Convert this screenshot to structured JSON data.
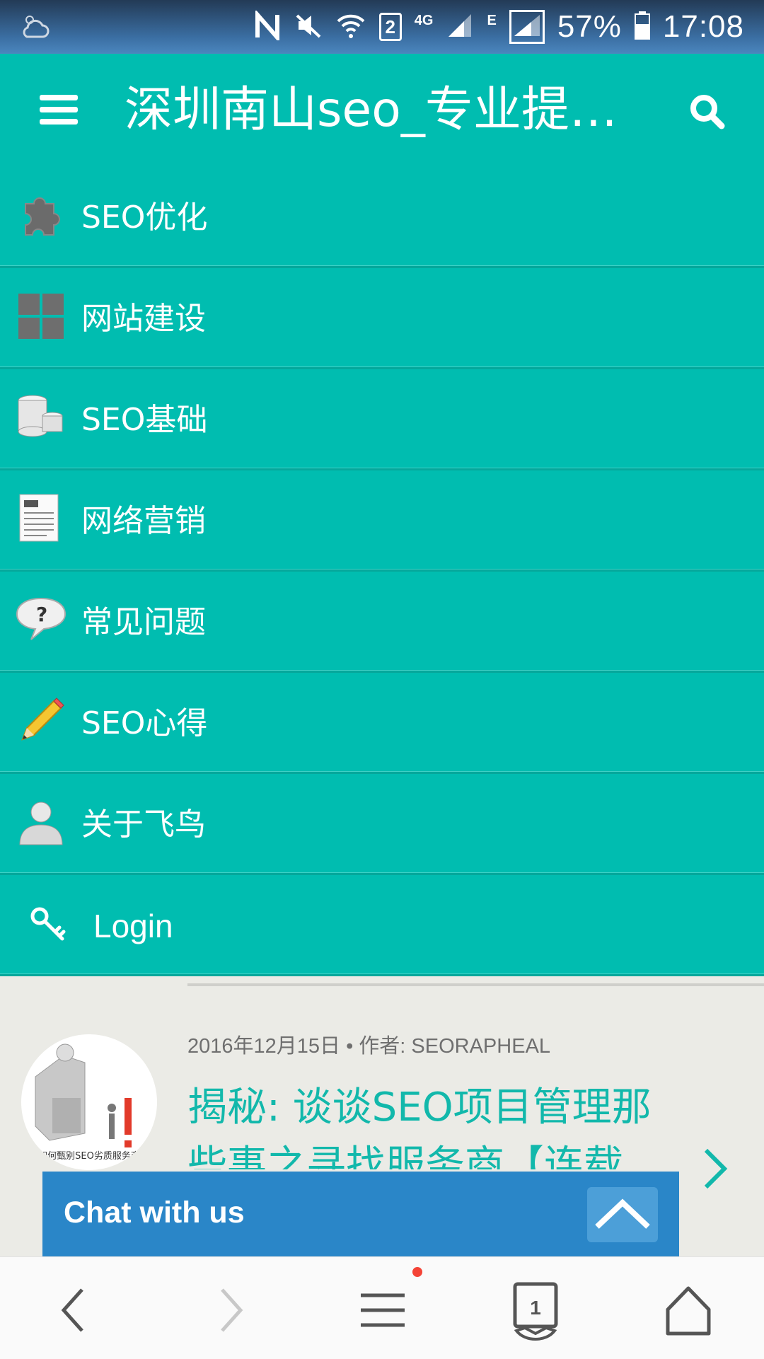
{
  "status_bar": {
    "battery": "57%",
    "time": "17:08",
    "sim_slot": "2",
    "network_4g": "4G",
    "network_e": "E",
    "icons": [
      "cloud-weather-icon",
      "nfc-icon",
      "mute-icon",
      "wifi-icon",
      "sim-icon",
      "signal-icon",
      "signal-icon",
      "battery-icon"
    ]
  },
  "app_bar": {
    "title": "深圳南山seo_专业提供…",
    "menu_icon": "hamburger-menu-icon",
    "search_icon": "search-icon"
  },
  "menu": {
    "items": [
      {
        "label": "SEO优化",
        "icon": "puzzle-piece-icon"
      },
      {
        "label": "网站建设",
        "icon": "grid-icon"
      },
      {
        "label": "SEO基础",
        "icon": "database-icon"
      },
      {
        "label": "网络营销",
        "icon": "document-icon"
      },
      {
        "label": "常见问题",
        "icon": "question-bubble-icon"
      },
      {
        "label": "SEO心得",
        "icon": "pencil-icon"
      },
      {
        "label": "关于飞鸟",
        "icon": "user-icon"
      },
      {
        "label": "Login",
        "icon": "key-icon"
      }
    ]
  },
  "post": {
    "meta": "2016年12月15日 • 作者: SEORAPHEAL",
    "title": "揭秘: 谈谈SEO项目管理那些事之寻找服务商【连载",
    "thumb_caption": "如何甄别SEO劣质服务商"
  },
  "chat": {
    "label": "Chat with us",
    "toggle_icon": "chevron-up-icon"
  },
  "browser_bar": {
    "tab_count": "1",
    "buttons": [
      "back-icon",
      "forward-icon",
      "menu-icon",
      "tabs-icon",
      "home-icon"
    ]
  },
  "colors": {
    "teal": "#00bdb0",
    "teal_text": "#12b8ab",
    "chat_blue": "#2a86c8",
    "background": "#ebebe6"
  }
}
